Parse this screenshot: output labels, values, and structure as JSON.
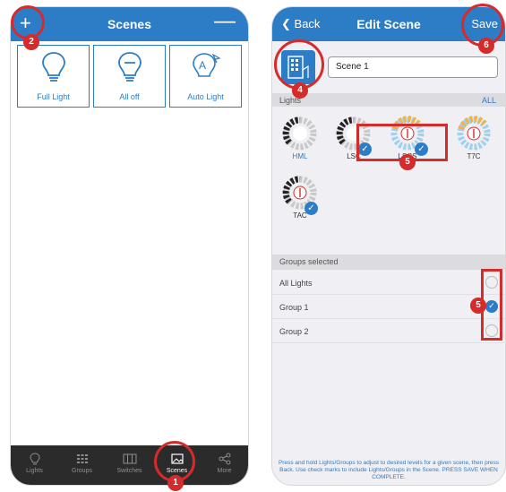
{
  "left": {
    "nav": {
      "add_symbol": "+",
      "title": "Scenes",
      "remove_symbol": "—"
    },
    "scenes": [
      {
        "label": "Full Light",
        "icon": "bulb-icon"
      },
      {
        "label": "All off",
        "icon": "bulb-minus-icon"
      },
      {
        "label": "Auto Light",
        "icon": "auto-bulb-icon"
      }
    ],
    "tabs": [
      {
        "label": "Lights",
        "icon": "bulb-icon"
      },
      {
        "label": "Groups",
        "icon": "groups-icon"
      },
      {
        "label": "Switches",
        "icon": "switch-icon"
      },
      {
        "label": "Scenes",
        "icon": "scenes-icon",
        "active": true
      },
      {
        "label": "More",
        "icon": "share-icon"
      }
    ]
  },
  "right": {
    "nav": {
      "back_label": "Back",
      "title": "Edit Scene",
      "save_label": "Save"
    },
    "scene_name": "Scene 1",
    "lights_header": "Lights",
    "all_label": "ALL",
    "lights": [
      {
        "label": "HML",
        "selected": false
      },
      {
        "label": "LSC",
        "selected": true
      },
      {
        "label": "LSCS",
        "selected": true
      },
      {
        "label": "T7C",
        "selected": false
      },
      {
        "label": "TAC",
        "selected": true
      }
    ],
    "groups_header": "Groups selected",
    "groups": [
      {
        "label": "All Lights",
        "checked": false
      },
      {
        "label": "Group 1",
        "checked": true
      },
      {
        "label": "Group 2",
        "checked": false
      }
    ],
    "footer": "Press and hold Lights/Groups to adjust to desired levels for a given scene, then press Back. Use check marks to include Lights/Groups in the Scene. PRESS SAVE WHEN COMPLETE."
  },
  "markers": {
    "m1": "1",
    "m2": "2",
    "m4": "4",
    "m5a": "5",
    "m5b": "5",
    "m6": "6"
  },
  "colors": {
    "brand_blue": "#2d7cc6",
    "marker_red": "#d52b2b",
    "tabbar": "#2b2b2b"
  }
}
